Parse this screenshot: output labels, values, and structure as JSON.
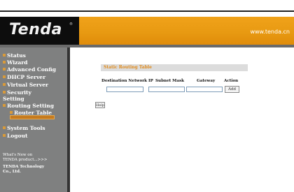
{
  "header": {
    "logo_text": "Tenda",
    "logo_mark": "®",
    "url": "www.tenda.cn"
  },
  "sidebar": {
    "items": [
      {
        "label": "Status"
      },
      {
        "label": "Wizard"
      },
      {
        "label": "Advanced Config"
      },
      {
        "label": "DHCP Server"
      },
      {
        "label": "Virtual Server"
      },
      {
        "label": "Security"
      },
      {
        "label": "Setting"
      },
      {
        "label": "Routing Setting"
      },
      {
        "label": "Router Table"
      },
      {
        "label": "System Tools"
      },
      {
        "label": "Logout"
      }
    ],
    "note_lines": [
      "What's New on",
      "TENDA product...>>>",
      "TENDA Technology",
      "Co., Ltd."
    ]
  },
  "main": {
    "panel_title": "Static Routing Table",
    "columns": [
      "Destination Network IP",
      "Subnet Mask",
      "Gateway",
      "Action"
    ],
    "inputs": {
      "destination_ip": "",
      "subnet_mask": "",
      "gateway": ""
    },
    "add_label": "Add",
    "help_label": "Help"
  }
}
